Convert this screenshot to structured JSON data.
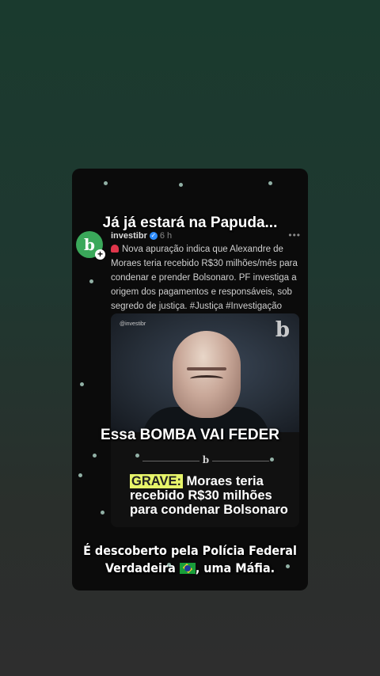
{
  "card": {
    "caption_top": "Já já estará na Papuda...",
    "caption_mid": "Essa BOMBA VAI FEDER",
    "caption_bottom_line1": "É descoberto pela Polícia Federal",
    "caption_bottom_line2_pre": "Verdadeira",
    "caption_bottom_line2_post": ", uma Máfia."
  },
  "post": {
    "avatar_letter": "b",
    "username": "investibr",
    "time": "6 h",
    "more": "•••",
    "body": "Nova apuração indica que Alexandre de Moraes teria recebido R$30 milhões/mês para condenar e prender Bolsonaro. PF investiga a origem dos pagamentos e responsáveis, sob segredo de justiça. #Justiça #Investigação"
  },
  "media": {
    "watermark": "@investibr",
    "logo": "b",
    "headline_tag": "GRAVE:",
    "headline_rest": " Moraes teria recebido R$30 milhões para condenar Bolsonaro"
  }
}
